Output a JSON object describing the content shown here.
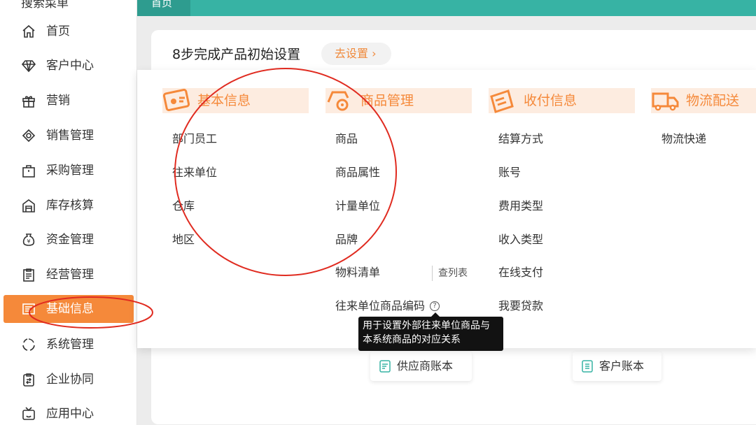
{
  "sidebar": {
    "clipped_top_label": "搜索菜单",
    "items": [
      {
        "label": "首页",
        "icon": "home-icon"
      },
      {
        "label": "客户中心",
        "icon": "diamond-icon"
      },
      {
        "label": "营销",
        "icon": "gift-icon"
      },
      {
        "label": "销售管理",
        "icon": "sales-icon"
      },
      {
        "label": "采购管理",
        "icon": "bag-icon"
      },
      {
        "label": "库存核算",
        "icon": "warehouse-icon"
      },
      {
        "label": "资金管理",
        "icon": "money-bag-icon"
      },
      {
        "label": "经营管理",
        "icon": "clipboard-icon"
      },
      {
        "label": "基础信息",
        "icon": "info-card-icon"
      },
      {
        "label": "系统管理",
        "icon": "cycle-icon"
      },
      {
        "label": "企业协同",
        "icon": "collab-icon"
      },
      {
        "label": "应用中心",
        "icon": "tv-icon"
      }
    ],
    "active_index": 8
  },
  "tabs": {
    "home": "首页"
  },
  "setup": {
    "title": "8步完成产品初始设置",
    "button": "去设置"
  },
  "accounts": {
    "supplier": "供应商账本",
    "customer": "客户账本"
  },
  "mega": {
    "categories": [
      {
        "title": "基本信息",
        "icon": "id-card-icon",
        "items": [
          "部门员工",
          "往来单位",
          "仓库",
          "地区"
        ]
      },
      {
        "title": "商品管理",
        "icon": "product-gear-icon",
        "items": [
          "商品",
          "商品属性",
          "计量单位",
          "品牌",
          "物料清单",
          "往来单位商品编码"
        ]
      },
      {
        "title": "收付信息",
        "icon": "payment-icon",
        "items": [
          "结算方式",
          "账号",
          "费用类型",
          "收入类型",
          "在线支付",
          "我要贷款"
        ]
      },
      {
        "title": "物流配送",
        "icon": "truck-icon",
        "items": [
          "物流快递"
        ]
      }
    ],
    "bom_link": "查列表"
  },
  "tooltip": {
    "lines": [
      "用于设置外部往来单位商品与",
      "本系统商品的对应关系"
    ]
  },
  "colors": {
    "accent": "#f5893a",
    "teal": "#37b3a4",
    "header_bg": "#fdece0",
    "annotation": "#e02b20"
  }
}
